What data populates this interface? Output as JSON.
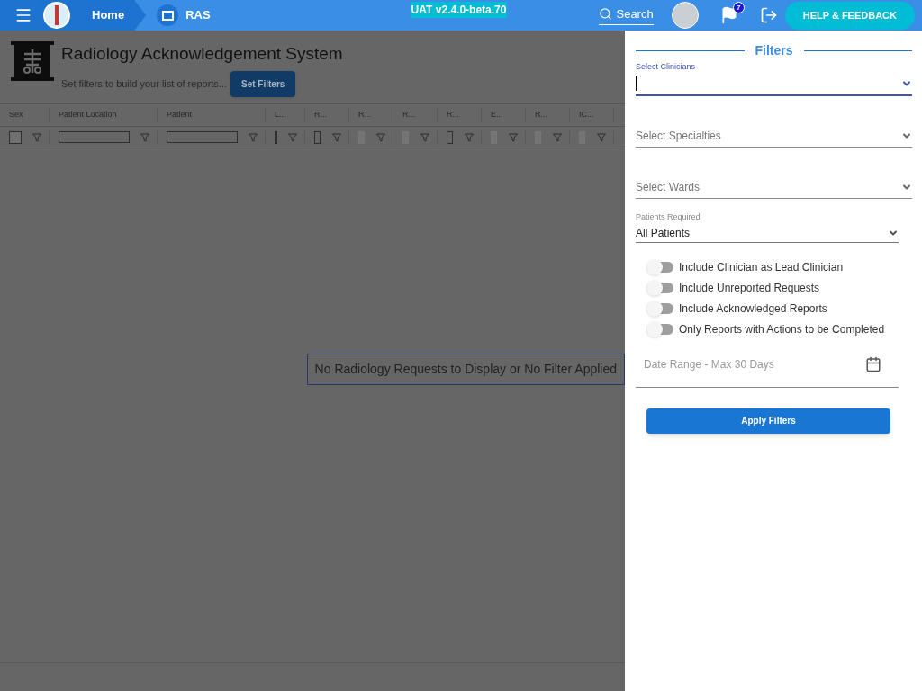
{
  "topbar": {
    "home": "Home",
    "module": "RAS",
    "version": "UAT v2.4.0-beta.70",
    "search": "Search",
    "notifications": "7",
    "help": "HELP & FEEDBACK"
  },
  "page": {
    "title": "Radiology Acknowledgement System",
    "subtitle": "Set filters to build your list of reports...",
    "set_filters": "Set Filters"
  },
  "table": {
    "columns": [
      {
        "label": "Sex",
        "kind": "check",
        "disabled": false
      },
      {
        "label": "Patient Location",
        "kind": "text",
        "disabled": false
      },
      {
        "label": "Patient",
        "kind": "text",
        "disabled": false
      },
      {
        "label": "L...",
        "kind": "box",
        "disabled": false
      },
      {
        "label": "R...",
        "kind": "box",
        "disabled": false
      },
      {
        "label": "R...",
        "kind": "box",
        "disabled": true
      },
      {
        "label": "R...",
        "kind": "box",
        "disabled": true
      },
      {
        "label": "R...",
        "kind": "box",
        "disabled": false
      },
      {
        "label": "E...",
        "kind": "box",
        "disabled": true
      },
      {
        "label": "R...",
        "kind": "box",
        "disabled": true
      },
      {
        "label": "IC...",
        "kind": "box",
        "disabled": true
      }
    ],
    "empty_message": "No Radiology Requests to Display or No Filter Applied"
  },
  "filters": {
    "title": "Filters",
    "fields": [
      {
        "label": "Select Clinicians",
        "focused": true
      },
      {
        "placeholder": "Select Specialties",
        "focused": false
      },
      {
        "placeholder": "Select Wards",
        "focused": false
      }
    ],
    "patients_required": {
      "label": "Patients Required",
      "value": "All Patients"
    },
    "toggles": [
      {
        "label": "Include Clinician as Lead Clinician",
        "on": false
      },
      {
        "label": "Include Unreported Requests",
        "on": false
      },
      {
        "label": "Include Acknowledged Reports",
        "on": false
      },
      {
        "label": "Only Reports with Actions to be Completed",
        "on": false
      }
    ],
    "date_range": {
      "placeholder": "Date Range - Max 30 Days"
    },
    "apply": "Apply Filters"
  }
}
